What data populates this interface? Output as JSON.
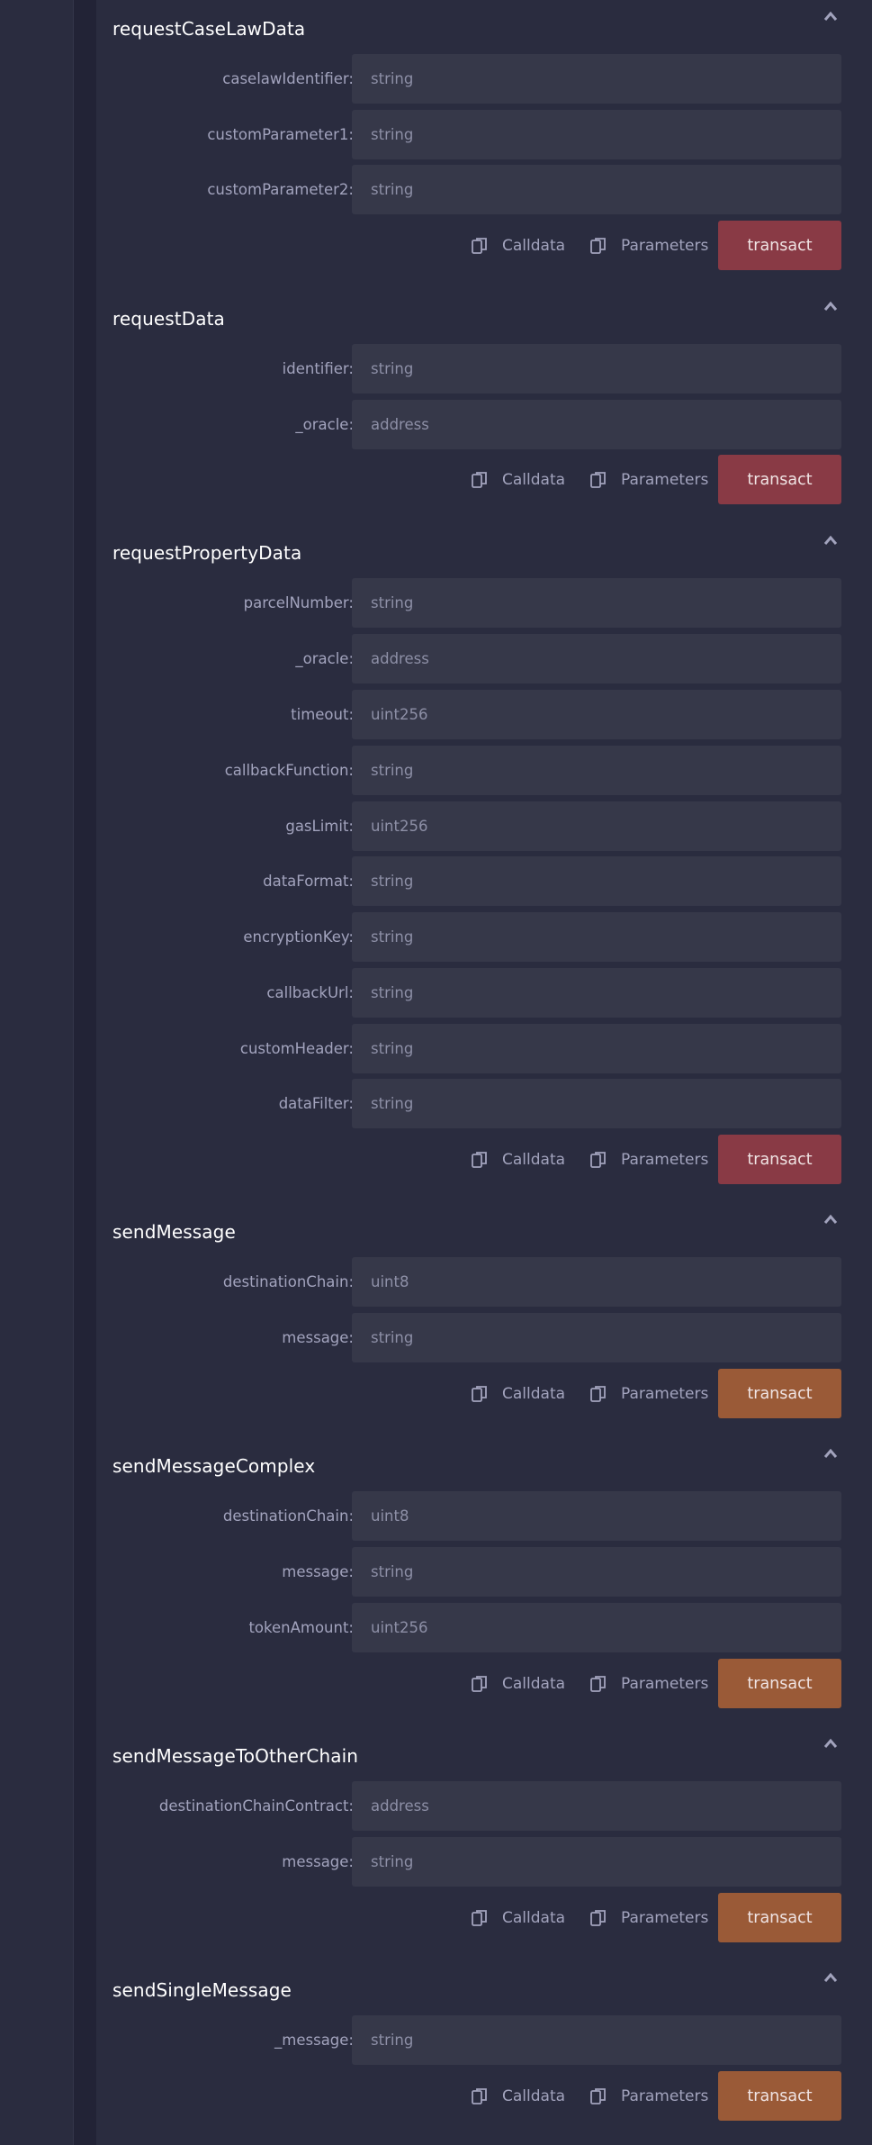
{
  "colors": {
    "background": "#2a2c3f",
    "input": "#363849",
    "transact_red": "#893a45",
    "transact_orange": "#9a5a37"
  },
  "actions": {
    "calldata": "Calldata",
    "parameters": "Parameters",
    "transact": "transact"
  },
  "functions": [
    {
      "name": "requestCaseLawData",
      "params": [
        {
          "label": "caselawIdentifier:",
          "placeholder": "string"
        },
        {
          "label": "customParameter1:",
          "placeholder": "string"
        },
        {
          "label": "customParameter2:",
          "placeholder": "string"
        }
      ]
    },
    {
      "name": "requestData",
      "params": [
        {
          "label": "identifier:",
          "placeholder": "string"
        },
        {
          "label": "_oracle:",
          "placeholder": "address"
        }
      ]
    },
    {
      "name": "requestPropertyData",
      "params": [
        {
          "label": "parcelNumber:",
          "placeholder": "string"
        },
        {
          "label": "_oracle:",
          "placeholder": "address"
        },
        {
          "label": "timeout:",
          "placeholder": "uint256"
        },
        {
          "label": "callbackFunction:",
          "placeholder": "string"
        },
        {
          "label": "gasLimit:",
          "placeholder": "uint256"
        },
        {
          "label": "dataFormat:",
          "placeholder": "string"
        },
        {
          "label": "encryptionKey:",
          "placeholder": "string"
        },
        {
          "label": "callbackUrl:",
          "placeholder": "string"
        },
        {
          "label": "customHeader:",
          "placeholder": "string"
        },
        {
          "label": "dataFilter:",
          "placeholder": "string"
        }
      ]
    },
    {
      "name": "sendMessage",
      "params": [
        {
          "label": "destinationChain:",
          "placeholder": "uint8"
        },
        {
          "label": "message:",
          "placeholder": "string"
        }
      ]
    },
    {
      "name": "sendMessageComplex",
      "params": [
        {
          "label": "destinationChain:",
          "placeholder": "uint8"
        },
        {
          "label": "message:",
          "placeholder": "string"
        },
        {
          "label": "tokenAmount:",
          "placeholder": "uint256"
        }
      ]
    },
    {
      "name": "sendMessageToOtherChain",
      "params": [
        {
          "label": "destinationChainContract:",
          "placeholder": "address"
        },
        {
          "label": "message:",
          "placeholder": "string"
        }
      ]
    },
    {
      "name": "sendSingleMessage",
      "params": [
        {
          "label": "_message:",
          "placeholder": "string"
        }
      ]
    }
  ]
}
